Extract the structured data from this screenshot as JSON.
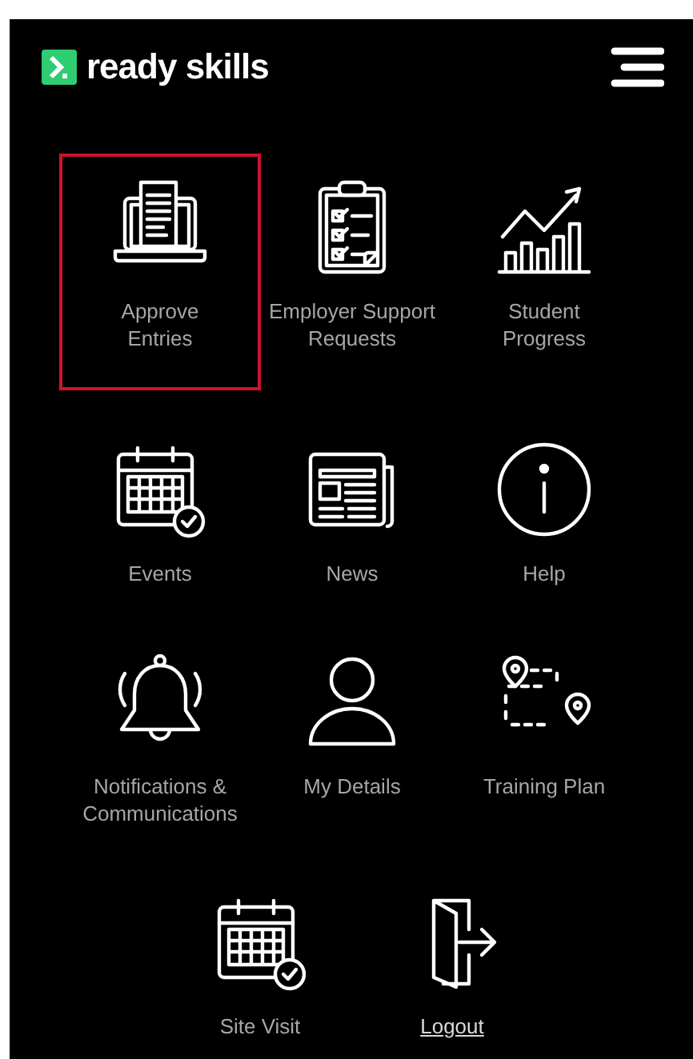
{
  "header": {
    "brand": "ready skills"
  },
  "tiles": [
    {
      "kind": "laptop",
      "label": "Approve Entries",
      "selected": true
    },
    {
      "kind": "clipboard",
      "label": "Employer Support Requests",
      "selected": false
    },
    {
      "kind": "chart",
      "label": "Student Progress",
      "selected": false
    },
    {
      "kind": "calendar",
      "label": "Events",
      "selected": false
    },
    {
      "kind": "news",
      "label": "News",
      "selected": false
    },
    {
      "kind": "info",
      "label": "Help",
      "selected": false
    },
    {
      "kind": "bell",
      "label": "Notifications & Communications",
      "selected": false
    },
    {
      "kind": "person",
      "label": "My Details",
      "selected": false
    },
    {
      "kind": "route",
      "label": "Training Plan",
      "selected": false
    }
  ],
  "bottom": [
    {
      "kind": "calendar",
      "label": "Site Visit",
      "selected": false
    },
    {
      "kind": "logout",
      "label": "Logout",
      "selected": false
    }
  ]
}
